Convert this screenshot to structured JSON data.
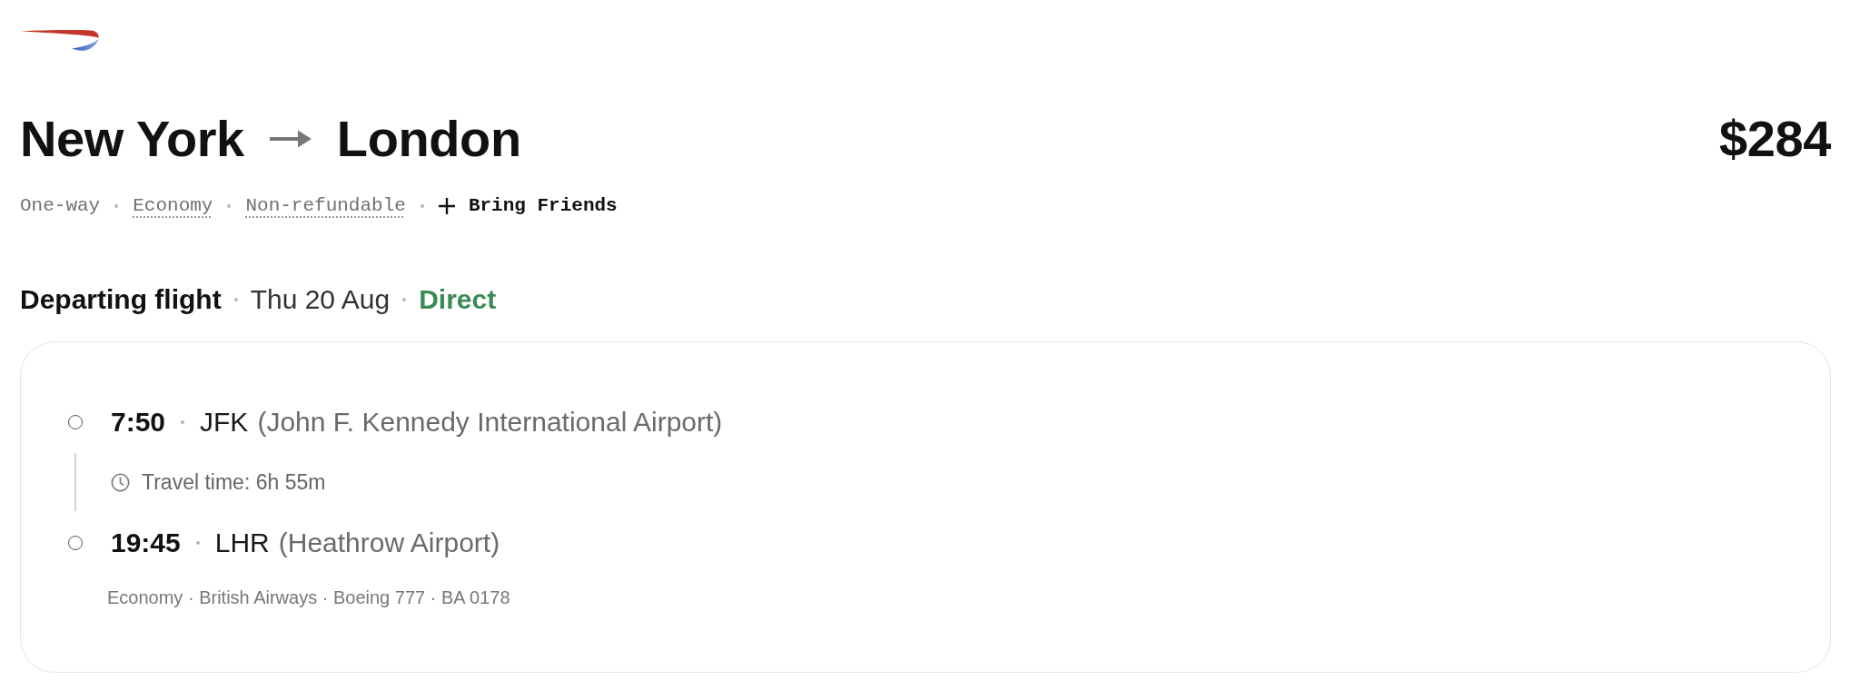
{
  "route": {
    "origin": "New York",
    "destination": "London"
  },
  "price": "$284",
  "fare_tags": [
    {
      "kind": "plain",
      "label": "One-way"
    },
    {
      "kind": "info",
      "label": "Economy"
    },
    {
      "kind": "info",
      "label": "Non-refundable"
    },
    {
      "kind": "action",
      "label": "Bring Friends"
    }
  ],
  "section": {
    "title": "Departing flight",
    "date": "Thu 20 Aug",
    "stops_label": "Direct"
  },
  "itinerary": {
    "stops": [
      {
        "time": "7:50",
        "code": "JFK",
        "airport": "(John F. Kennedy International Airport)"
      },
      {
        "time": "19:45",
        "code": "LHR",
        "airport": "(Heathrow Airport)"
      }
    ],
    "travel_time": "Travel time: 6h 55m",
    "details": "Economy · British Airways · Boeing 777 · BA 0178"
  }
}
